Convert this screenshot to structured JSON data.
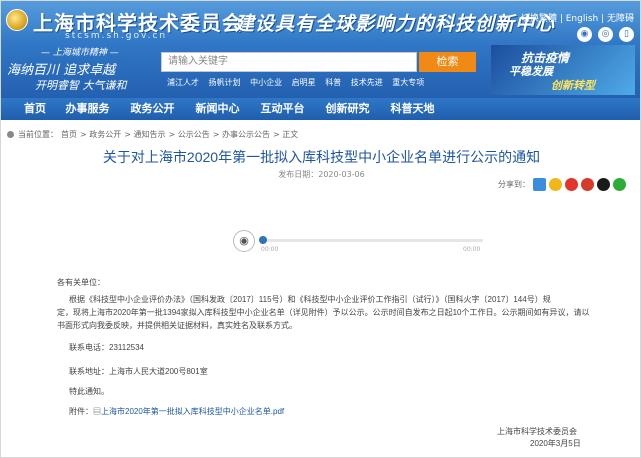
{
  "header": {
    "site_title": "上海市科学技术委员会",
    "site_url": "stcsm.sh.gov.cn",
    "slogan": "建设具有全球影响力的科技创新中心",
    "top_links": "切换繁體 | English | 无障碍",
    "spirit_label": "— 上海城市精神 —",
    "spirit_line1": "海纳百川  追求卓越",
    "spirit_line2": "开明睿智  大气谦和",
    "banner_line1": "抗击疫情",
    "banner_line2": "平稳发展",
    "banner_line3": "创新转型"
  },
  "search": {
    "placeholder": "请输入关键字",
    "button_label": "检索",
    "hotwords": [
      "浦江人才",
      "扬帆计划",
      "中小企业",
      "启明星",
      "科普",
      "技术先进",
      "重大专项"
    ]
  },
  "nav": [
    "首页",
    "办事服务",
    "政务公开",
    "新闻中心",
    "互动平台",
    "创新研究",
    "科普天地"
  ],
  "breadcrumb": {
    "label": "当前位置：",
    "items": [
      "首页",
      "政务公开",
      "通知告示",
      "公示公告",
      "办事公示公告",
      "正文"
    ]
  },
  "article": {
    "title": "关于对上海市2020年第一批拟入库科技型中小企业名单进行公示的通知",
    "pub_date": "发布日期：2020-03-06",
    "share_label": "分享到：",
    "player": {
      "current": "00:00",
      "total": "00:00"
    },
    "greeting": "各有关单位：",
    "body_line1": "根据《科技型中小企业评价办法》（国科发政〔2017〕115号）和《科技型中小企业评价工作指引（试行）》（国科火字〔2017〕144号）规",
    "body_line2": "定，现将上海市2020年第一批1394家拟入库科技型中小企业名单（详见附件）予以公示。公示时间自发布之日起10个工作日。公示期间如有异议，请以书面形式向我委反映，并提供相关证据材料，真实姓名及联系方式。",
    "contact_tel": "联系电话：23112534",
    "contact_addr": "联系地址：上海市人民大道200号801室",
    "notice": "特此通知。",
    "attachment_label": "附件：",
    "attachment_name": "上海市2020年第一批拟入库科技型中小企业名单.pdf",
    "sign_org": "上海市科学技术委员会",
    "sign_date": "2020年3月5日"
  },
  "colors": {
    "header_blue": "#2e72c2",
    "title_blue": "#1d56a5",
    "search_orange": "#f08a14"
  }
}
